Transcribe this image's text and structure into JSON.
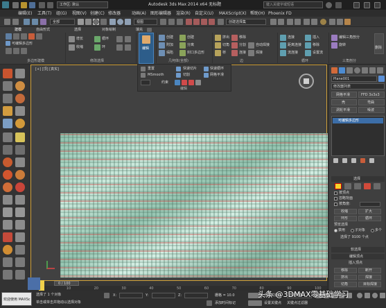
{
  "titlebar": {
    "workspace_label": "工作区: 默认",
    "title": "Autodesk 3ds Max  2014 x64    无标题",
    "search_placeholder": "键入关键字或短语"
  },
  "menubar": {
    "items": [
      "编辑(E)",
      "工具(T)",
      "组(G)",
      "视图(V)",
      "创建(C)",
      "修改器",
      "动画(A)",
      "图形编辑器",
      "渲染(R)",
      "自定义(U)",
      "MAXScript(X)",
      "帮助(H)",
      "Phoenix FD"
    ]
  },
  "toolbar": {
    "filter_value": "全部",
    "view_value": "视图",
    "selection_set_placeholder": "创建选择集"
  },
  "ribbon": {
    "tabs": [
      "建模",
      "自由形式",
      "选择",
      "对象绘制",
      "填充"
    ],
    "left_items": [
      "可编辑多边形"
    ],
    "group_labels": [
      "多边形建模",
      "修改选择",
      "编辑",
      "几何体(全部)",
      "边",
      "循环",
      "三角剖分"
    ],
    "modify_items": [
      "增长",
      "收缩",
      "循环",
      "环"
    ],
    "edit_items": [
      "模型",
      "网格平滑",
      "约束",
      "切片"
    ],
    "geometry_items": [
      "创建",
      "附加",
      "塌陷",
      "分离",
      "封口多边形"
    ],
    "edge_items": [
      "挤出",
      "切角",
      "桥",
      "移除",
      "分割",
      "连接",
      "自动焊接",
      "焊接"
    ],
    "loop_items": [
      "连接",
      "距离连接",
      "流连接",
      "插入",
      "移除",
      "设置流"
    ],
    "tri_items": [
      "编辑三角剖分",
      "旋转",
      "删除"
    ]
  },
  "dropdown_panel": {
    "items": [
      "重置",
      "MSmooth",
      "快速切片",
      "切割",
      "快速循环",
      "网格平滑",
      "约束"
    ],
    "footer": "编辑"
  },
  "viewport": {
    "label": "[+] [顶] [真实]",
    "frame_counter": "0 / 100"
  },
  "command_panel": {
    "object_name": "Plane001",
    "modifier_list": "修改器列表",
    "buttons": [
      "网格平滑",
      "FFD 3x3x3",
      "壳",
      "弯曲",
      "涡轮平滑",
      "噪波"
    ],
    "stack_item": "可编辑多边形",
    "rollouts": {
      "selection": "选择",
      "soft_selection": "软选择",
      "edit_vertices": "编辑顶点"
    },
    "selection_options": [
      "按顶点",
      "忽略背面",
      "按角度:",
      "收缩",
      "扩大",
      "环形",
      "循环"
    ],
    "preview_selection": "预览选择",
    "preview_options": [
      "禁用",
      "子对象",
      "多个"
    ],
    "selected_status": "选择了 9100 个点",
    "edit_vertex_buttons": [
      "移除",
      "断开",
      "挤出",
      "焊接",
      "切角",
      "目标焊接",
      "连接"
    ],
    "insert_vertex_label": "插入顶点"
  },
  "timeline": {
    "ticks": [
      "0",
      "10",
      "20",
      "30",
      "40",
      "50",
      "60",
      "70",
      "80",
      "90",
      "100"
    ]
  },
  "statusbar": {
    "welcome": "欢迎使用 MAXSc",
    "selected": "选择了 1 个对象",
    "hint": "单击或单击并拖动以选择对象",
    "grid_label": "栅格 = 10.0",
    "add_time_tag": "添加时间标记",
    "auto_key": "自动关键点",
    "selected_obj": "选定对象",
    "set_key": "设置关键点",
    "key_filter": "关键点过滤器"
  },
  "watermark": {
    "text": "头条 @3DMAX零基础学习"
  },
  "colors": {
    "viewport_bg": "#414141",
    "plane_base": "#a9d5c3",
    "grid_red": "#c93a3a",
    "grid_dark": "#48705f",
    "accent_blue": "#5a8fd6",
    "selected_yellow": "#f5d32c"
  }
}
